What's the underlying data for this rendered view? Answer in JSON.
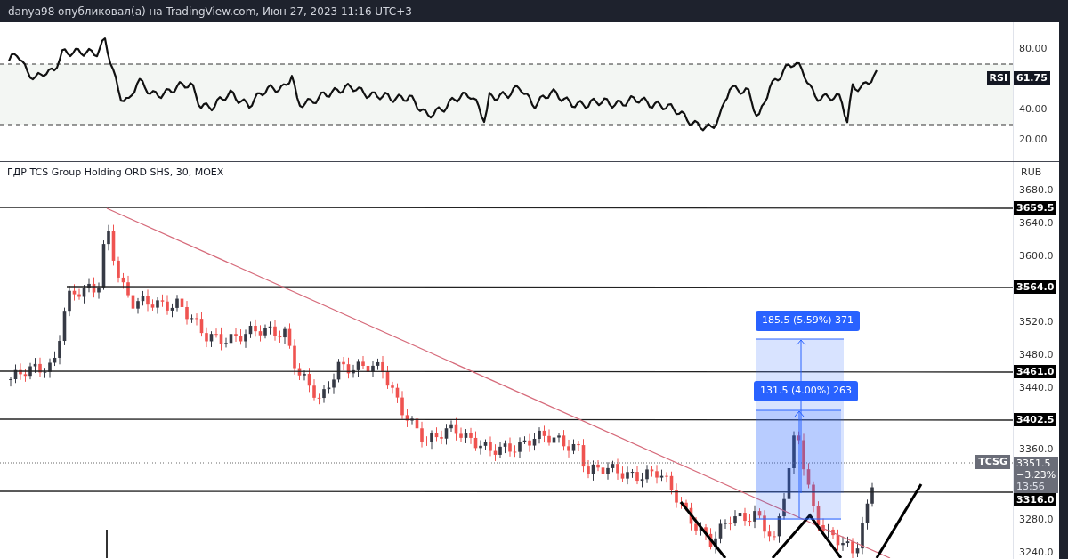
{
  "header": {
    "text": "danya98 опубликовал(а) на TradingView.com, Июн 27, 2023 11:16 UTC+3"
  },
  "rsi_pane": {
    "ticks": [
      "80.00",
      "40.00",
      "20.00"
    ],
    "indicator_badge": "RSI",
    "value": "61.75"
  },
  "main_pane": {
    "legend": "ГДР TCS Group Holding ORD SHS, 30, MOEX",
    "currency": "RUB",
    "ticks": [
      "3680.0",
      "3640.0",
      "3600.0",
      "3520.0",
      "3480.0",
      "3440.0",
      "3360.0",
      "3280.0",
      "3240.0"
    ],
    "level_labels": [
      "3659.5",
      "3564.0",
      "3461.0",
      "3402.5",
      "3316.0"
    ],
    "symbol_badge": "TCSG",
    "last_price": {
      "price": "3351.5",
      "change": "−3.23%",
      "countdown": "13:56"
    },
    "measures": [
      "185.5 (5.59%) 371",
      "131.5 (4.00%) 263"
    ]
  }
}
